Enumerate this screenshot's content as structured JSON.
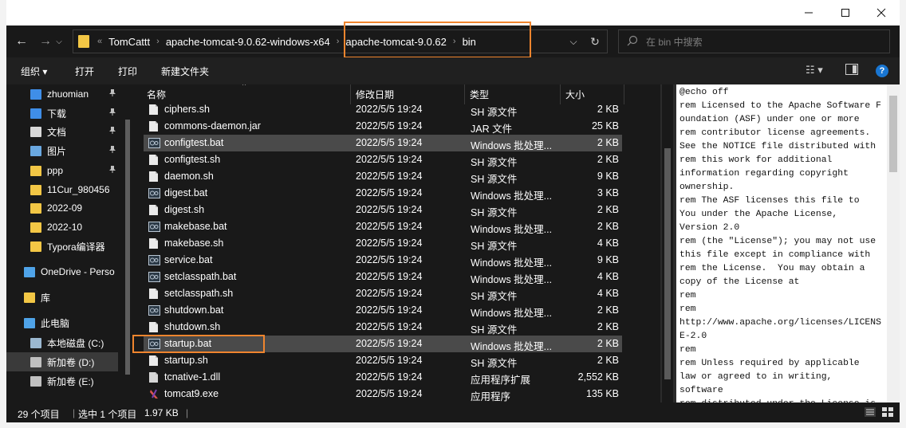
{
  "window": {
    "minimize_icon": "minimize-icon",
    "maximize_icon": "maximize-icon",
    "close_icon": "close-icon"
  },
  "navigation": {
    "back": "←",
    "forward": "→",
    "dropdown": "⌵",
    "up": "↑"
  },
  "address": {
    "overflow": "«",
    "crumbs": [
      "TomCattt",
      "apache-tomcat-9.0.62-windows-x64",
      "apache-tomcat-9.0.62",
      "bin"
    ],
    "separator": "›",
    "refresh": "↻",
    "dropdown": "⌵"
  },
  "search": {
    "placeholder": "在 bin 中搜索"
  },
  "toolbar": {
    "organize": "组织 ▾",
    "open": "打开",
    "print": "打印",
    "new_folder": "新建文件夹",
    "view_options": "☷ ▾",
    "help": "?"
  },
  "sidebar": {
    "items": [
      {
        "label": "zhuomian",
        "pinned": true,
        "color": "#3f8ee8"
      },
      {
        "label": "下载",
        "pinned": true,
        "color": "#3f8ee8"
      },
      {
        "label": "文档",
        "pinned": true,
        "color": "#d8d8d8"
      },
      {
        "label": "图片",
        "pinned": true,
        "color": "#6aa8e0"
      },
      {
        "label": "ppp",
        "pinned": true,
        "color": "#f3c745"
      },
      {
        "label": "11Cur_980456",
        "pinned": false,
        "color": "#f3c745"
      },
      {
        "label": "2022-09",
        "pinned": false,
        "color": "#f3c745"
      },
      {
        "label": "2022-10",
        "pinned": false,
        "color": "#f3c745"
      },
      {
        "label": "Typora编译器",
        "pinned": false,
        "color": "#f3c745"
      },
      {
        "label": "OneDrive - Perso",
        "pinned": false,
        "color": "#4fa3e8"
      },
      {
        "label": "库",
        "pinned": false,
        "color": "#f3c745"
      },
      {
        "label": "此电脑",
        "pinned": false,
        "color": "#4fa3e8"
      },
      {
        "label": "本地磁盘 (C:)",
        "pinned": false,
        "color": "#9bb8d0"
      },
      {
        "label": "新加卷 (D:)",
        "pinned": false,
        "color": "#c0c0c0",
        "selected": true
      },
      {
        "label": "新加卷 (E:)",
        "pinned": false,
        "color": "#c0c0c0"
      }
    ],
    "pin_glyph": "📌"
  },
  "columns": {
    "name": "名称",
    "modified": "修改日期",
    "type": "类型",
    "size": "大小"
  },
  "files": [
    {
      "name": "ciphers.sh",
      "modified": "2022/5/5 19:24",
      "type": "SH 源文件",
      "size": "2 KB",
      "icon": "sh"
    },
    {
      "name": "commons-daemon.jar",
      "modified": "2022/5/5 19:24",
      "type": "JAR 文件",
      "size": "25 KB",
      "icon": "doc"
    },
    {
      "name": "configtest.bat",
      "modified": "2022/5/5 19:24",
      "type": "Windows 批处理...",
      "size": "2 KB",
      "icon": "bat",
      "selected": true
    },
    {
      "name": "configtest.sh",
      "modified": "2022/5/5 19:24",
      "type": "SH 源文件",
      "size": "2 KB",
      "icon": "sh"
    },
    {
      "name": "daemon.sh",
      "modified": "2022/5/5 19:24",
      "type": "SH 源文件",
      "size": "9 KB",
      "icon": "sh"
    },
    {
      "name": "digest.bat",
      "modified": "2022/5/5 19:24",
      "type": "Windows 批处理...",
      "size": "3 KB",
      "icon": "bat"
    },
    {
      "name": "digest.sh",
      "modified": "2022/5/5 19:24",
      "type": "SH 源文件",
      "size": "2 KB",
      "icon": "sh"
    },
    {
      "name": "makebase.bat",
      "modified": "2022/5/5 19:24",
      "type": "Windows 批处理...",
      "size": "2 KB",
      "icon": "bat"
    },
    {
      "name": "makebase.sh",
      "modified": "2022/5/5 19:24",
      "type": "SH 源文件",
      "size": "4 KB",
      "icon": "sh"
    },
    {
      "name": "service.bat",
      "modified": "2022/5/5 19:24",
      "type": "Windows 批处理...",
      "size": "9 KB",
      "icon": "bat"
    },
    {
      "name": "setclasspath.bat",
      "modified": "2022/5/5 19:24",
      "type": "Windows 批处理...",
      "size": "4 KB",
      "icon": "bat"
    },
    {
      "name": "setclasspath.sh",
      "modified": "2022/5/5 19:24",
      "type": "SH 源文件",
      "size": "4 KB",
      "icon": "sh"
    },
    {
      "name": "shutdown.bat",
      "modified": "2022/5/5 19:24",
      "type": "Windows 批处理...",
      "size": "2 KB",
      "icon": "bat"
    },
    {
      "name": "shutdown.sh",
      "modified": "2022/5/5 19:24",
      "type": "SH 源文件",
      "size": "2 KB",
      "icon": "sh"
    },
    {
      "name": "startup.bat",
      "modified": "2022/5/5 19:24",
      "type": "Windows 批处理...",
      "size": "2 KB",
      "icon": "bat",
      "selected": true
    },
    {
      "name": "startup.sh",
      "modified": "2022/5/5 19:24",
      "type": "SH 源文件",
      "size": "2 KB",
      "icon": "sh"
    },
    {
      "name": "tcnative-1.dll",
      "modified": "2022/5/5 19:24",
      "type": "应用程序扩展",
      "size": "2,552 KB",
      "icon": "dll"
    },
    {
      "name": "tomcat9.exe",
      "modified": "2022/5/5 19:24",
      "type": "应用程序",
      "size": "135 KB",
      "icon": "exe"
    }
  ],
  "preview": {
    "text": "@echo off\nrem Licensed to the Apache Software Foundation (ASF) under one or more\nrem contributor license agreements.\nSee the NOTICE file distributed with\nrem this work for additional\ninformation regarding copyright\nownership.\nrem The ASF licenses this file to\nYou under the Apache License,\nVersion 2.0\nrem (the \"License\"); you may not use\nthis file except in compliance with\nrem the License.  You may obtain a\ncopy of the License at\nrem\nrem\nhttp://www.apache.org/licenses/LICENSE-2.0\nrem\nrem Unless required by applicable\nlaw or agreed to in writing,\nsoftware\nrem distributed under the License is"
  },
  "status": {
    "count": "29 个项目",
    "selection": "选中 1 个项目",
    "size": "1.97 KB"
  },
  "colors": {
    "highlight": "#f0852e",
    "folder": "#f3c745",
    "accent": "#1976d2"
  }
}
